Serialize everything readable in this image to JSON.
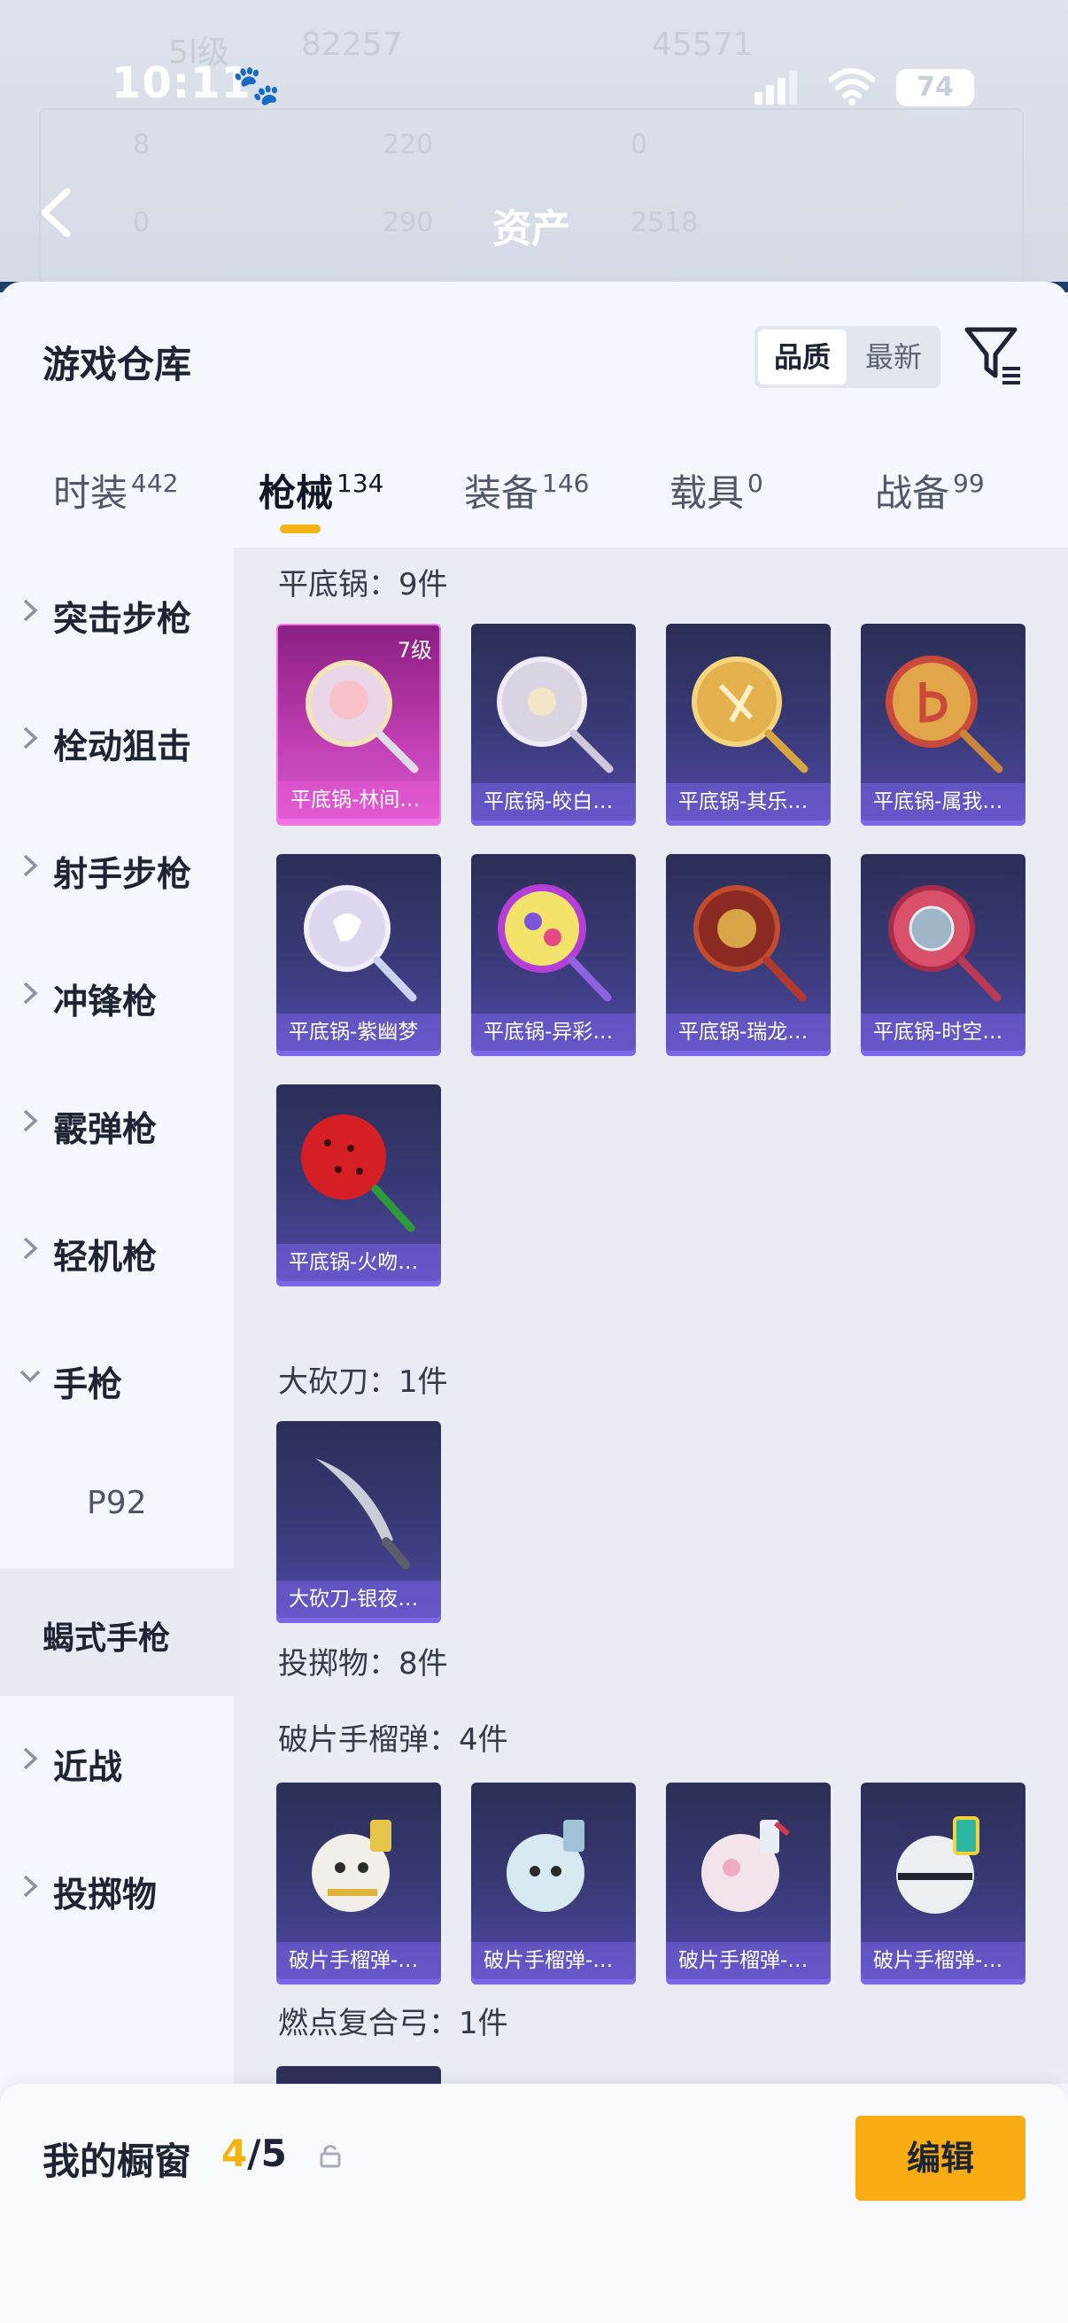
{
  "status_bar": {
    "time": "10:11",
    "battery": "74"
  },
  "background": {
    "title": "资产",
    "ghost_values": [
      "5l级",
      "82257",
      "45571",
      "8",
      "220",
      "0",
      "0",
      "290",
      "2518"
    ]
  },
  "sheet": {
    "title": "游戏仓库",
    "sort": {
      "quality": "品质",
      "newest": "最新"
    },
    "tabs": [
      {
        "label": "时装",
        "count": "442"
      },
      {
        "label": "枪械",
        "count": "134"
      },
      {
        "label": "装备",
        "count": "146"
      },
      {
        "label": "载具",
        "count": "0"
      },
      {
        "label": "战备",
        "count": "99"
      }
    ],
    "active_tab": "枪械"
  },
  "sidebar": {
    "categories": [
      {
        "label": "突击步枪"
      },
      {
        "label": "栓动狙击"
      },
      {
        "label": "射手步枪"
      },
      {
        "label": "冲锋枪"
      },
      {
        "label": "霰弹枪"
      },
      {
        "label": "轻机枪"
      },
      {
        "label": "手枪"
      },
      {
        "label": "P92"
      },
      {
        "label": "蝎式手枪"
      },
      {
        "label": "近战"
      },
      {
        "label": "投掷物"
      }
    ]
  },
  "content": {
    "sections": [
      {
        "title": "平底锅：9件"
      },
      {
        "title": "大砍刀：1件"
      },
      {
        "title": "投掷物：8件"
      },
      {
        "title": "破片手榴弹：4件"
      },
      {
        "title": "燃点复合弓：1件"
      }
    ],
    "pans": [
      {
        "name": "平底锅-林间…",
        "level": "7级"
      },
      {
        "name": "平底锅-皎白…"
      },
      {
        "name": "平底锅-其乐…"
      },
      {
        "name": "平底锅-属我…"
      },
      {
        "name": "平底锅-紫幽梦"
      },
      {
        "name": "平底锅-异彩…"
      },
      {
        "name": "平底锅-瑞龙…"
      },
      {
        "name": "平底锅-时空…"
      },
      {
        "name": "平底锅-火吻…"
      }
    ],
    "machete": [
      {
        "name": "大砍刀-银夜…"
      }
    ],
    "grenades": [
      {
        "name": "破片手榴弹-…"
      },
      {
        "name": "破片手榴弹-…"
      },
      {
        "name": "破片手榴弹-…"
      },
      {
        "name": "破片手榴弹-…"
      }
    ]
  },
  "bottom_bar": {
    "label": "我的橱窗",
    "current": "4",
    "total": "/5",
    "edit_label": "编辑"
  },
  "colors": {
    "accent": "#f4b315",
    "card_purple": "#3a3b7a",
    "card_pink": "#c23fb4"
  }
}
